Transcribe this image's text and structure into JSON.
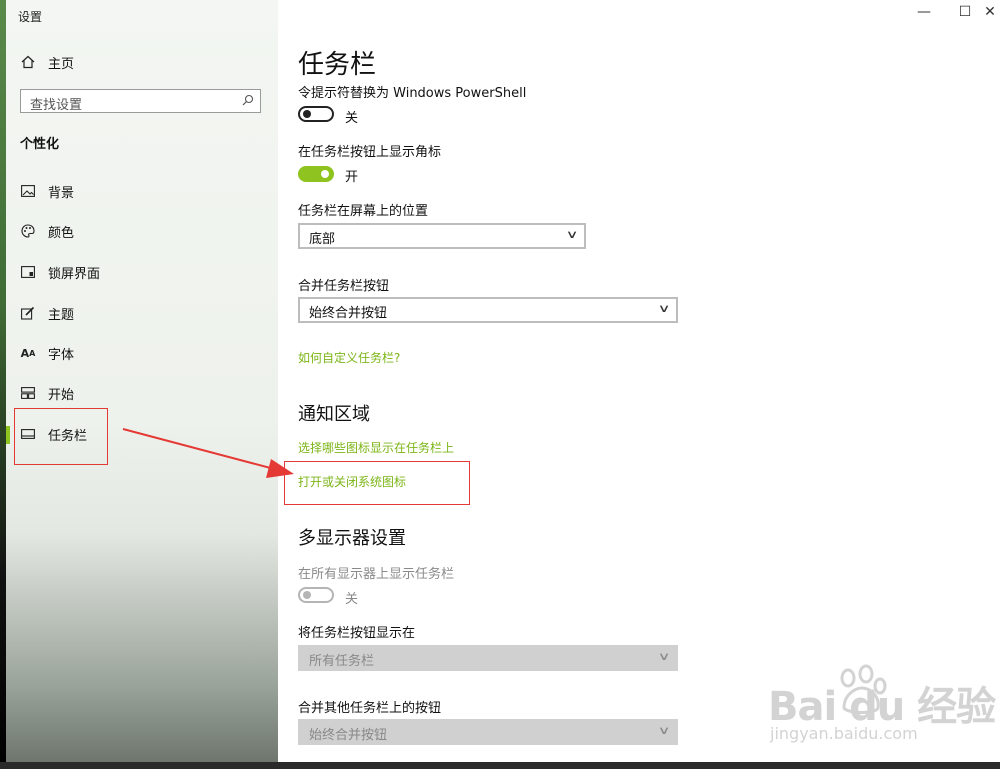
{
  "window": {
    "title": "设置",
    "controls": [
      "—",
      "☐",
      "✕"
    ]
  },
  "sidebar": {
    "home_label": "主页",
    "search_placeholder": "查找设置",
    "section": "个性化",
    "items": [
      {
        "label": "背景",
        "icon": "image-icon"
      },
      {
        "label": "颜色",
        "icon": "palette-icon"
      },
      {
        "label": "锁屏界面",
        "icon": "lockscreen-icon"
      },
      {
        "label": "主题",
        "icon": "theme-brush-icon"
      },
      {
        "label": "字体",
        "icon": "font-icon"
      },
      {
        "label": "开始",
        "icon": "start-menu-icon"
      },
      {
        "label": "任务栏",
        "icon": "taskbar-icon",
        "active": true
      }
    ]
  },
  "main": {
    "title": "任务栏",
    "powershell": {
      "label": "令提示符替换为 Windows PowerShell",
      "state": "关"
    },
    "badges": {
      "label": "在任务栏按钮上显示角标",
      "state": "开"
    },
    "position": {
      "label": "任务栏在屏幕上的位置",
      "value": "底部"
    },
    "combine": {
      "label": "合并任务栏按钮",
      "value": "始终合并按钮"
    },
    "customize_link": "如何自定义任务栏?",
    "notification": {
      "heading": "通知区域",
      "link1": "选择哪些图标显示在任务栏上",
      "link2": "打开或关闭系统图标"
    },
    "multi": {
      "heading": "多显示器设置",
      "show_all": {
        "label": "在所有显示器上显示任务栏",
        "state": "关"
      },
      "show_buttons": {
        "label": "将任务栏按钮显示在",
        "value": "所有任务栏"
      },
      "combine_other": {
        "label": "合并其他任务栏上的按钮",
        "value": "始终合并按钮"
      }
    }
  },
  "watermark": {
    "brand": "Bai du 经验",
    "url": "jingyan.baidu.com"
  },
  "colors": {
    "accent": "#8fc31f",
    "link": "#7cb518",
    "annotation": "#e53935"
  }
}
